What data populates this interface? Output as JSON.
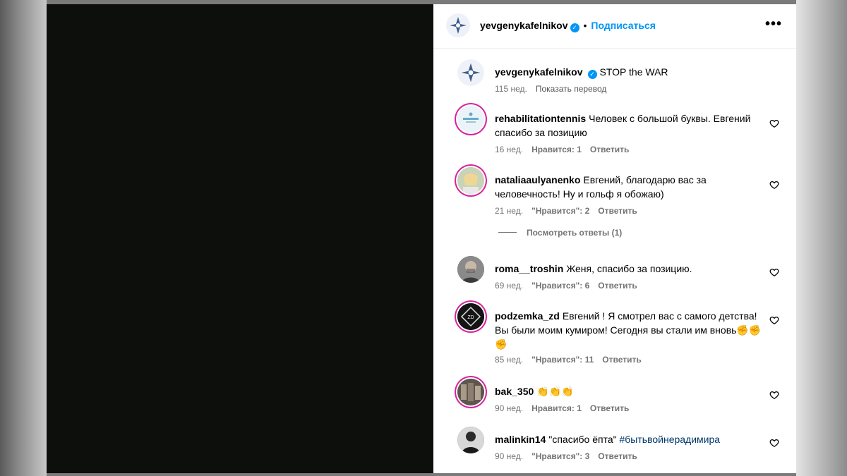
{
  "header": {
    "username": "yevgenykafelnikov",
    "separator": "•",
    "follow_label": "Подписаться",
    "more_label": "•••"
  },
  "caption": {
    "username": "yevgenykafelnikov",
    "text": "STOP the WAR",
    "time": "115 нед.",
    "translate_label": "Показать перевод"
  },
  "comments": [
    {
      "username": "rehabilitationtennis",
      "text": "Человек с большой буквы. Евгений спасибо за позицию",
      "time": "16 нед.",
      "likes": "Нравится: 1",
      "reply": "Ответить",
      "avatar_color": "#e8f2f7"
    },
    {
      "username": "nataliaaulyanenko",
      "text": "Евгений, благодарю вас за человечность! Ну и гольф я обожаю)",
      "time": "21 нед.",
      "likes": "\"Нравится\": 2",
      "reply": "Ответить",
      "avatar_color": "#d8c8a8"
    },
    {
      "username": "roma__troshin",
      "text": "Женя, спасибо за позицию.",
      "time": "69 нед.",
      "likes": "\"Нравится\": 6",
      "reply": "Ответить",
      "avatar_color": "#6f6f6f"
    },
    {
      "username": "podzemka_zd",
      "text": "Евгений ! Я смотрел вас с самого детства! Вы были моим кумиром! Сегодня вы стали им вновь✊✊✊",
      "time": "85 нед.",
      "likes": "\"Нравится\": 11",
      "reply": "Ответить",
      "avatar_color": "#1a1a1a"
    },
    {
      "username": "bak_350",
      "text": "👏👏👏",
      "time": "90 нед.",
      "likes": "Нравится: 1",
      "reply": "Ответить",
      "avatar_color": "#6b5f55"
    },
    {
      "username": "malinkin14",
      "text": "\"спасибо ёпта\"",
      "hashtag": "#бытьвойнерадимира",
      "time": "90 нед.",
      "likes": "\"Нравится\": 3",
      "reply": "Ответить",
      "avatar_color": "#333333"
    }
  ],
  "view_replies_label": "Посмотреть ответы (1)",
  "colors": {
    "accent": "#0095f6",
    "secondary_text": "#737373",
    "hashtag": "#00376b"
  }
}
